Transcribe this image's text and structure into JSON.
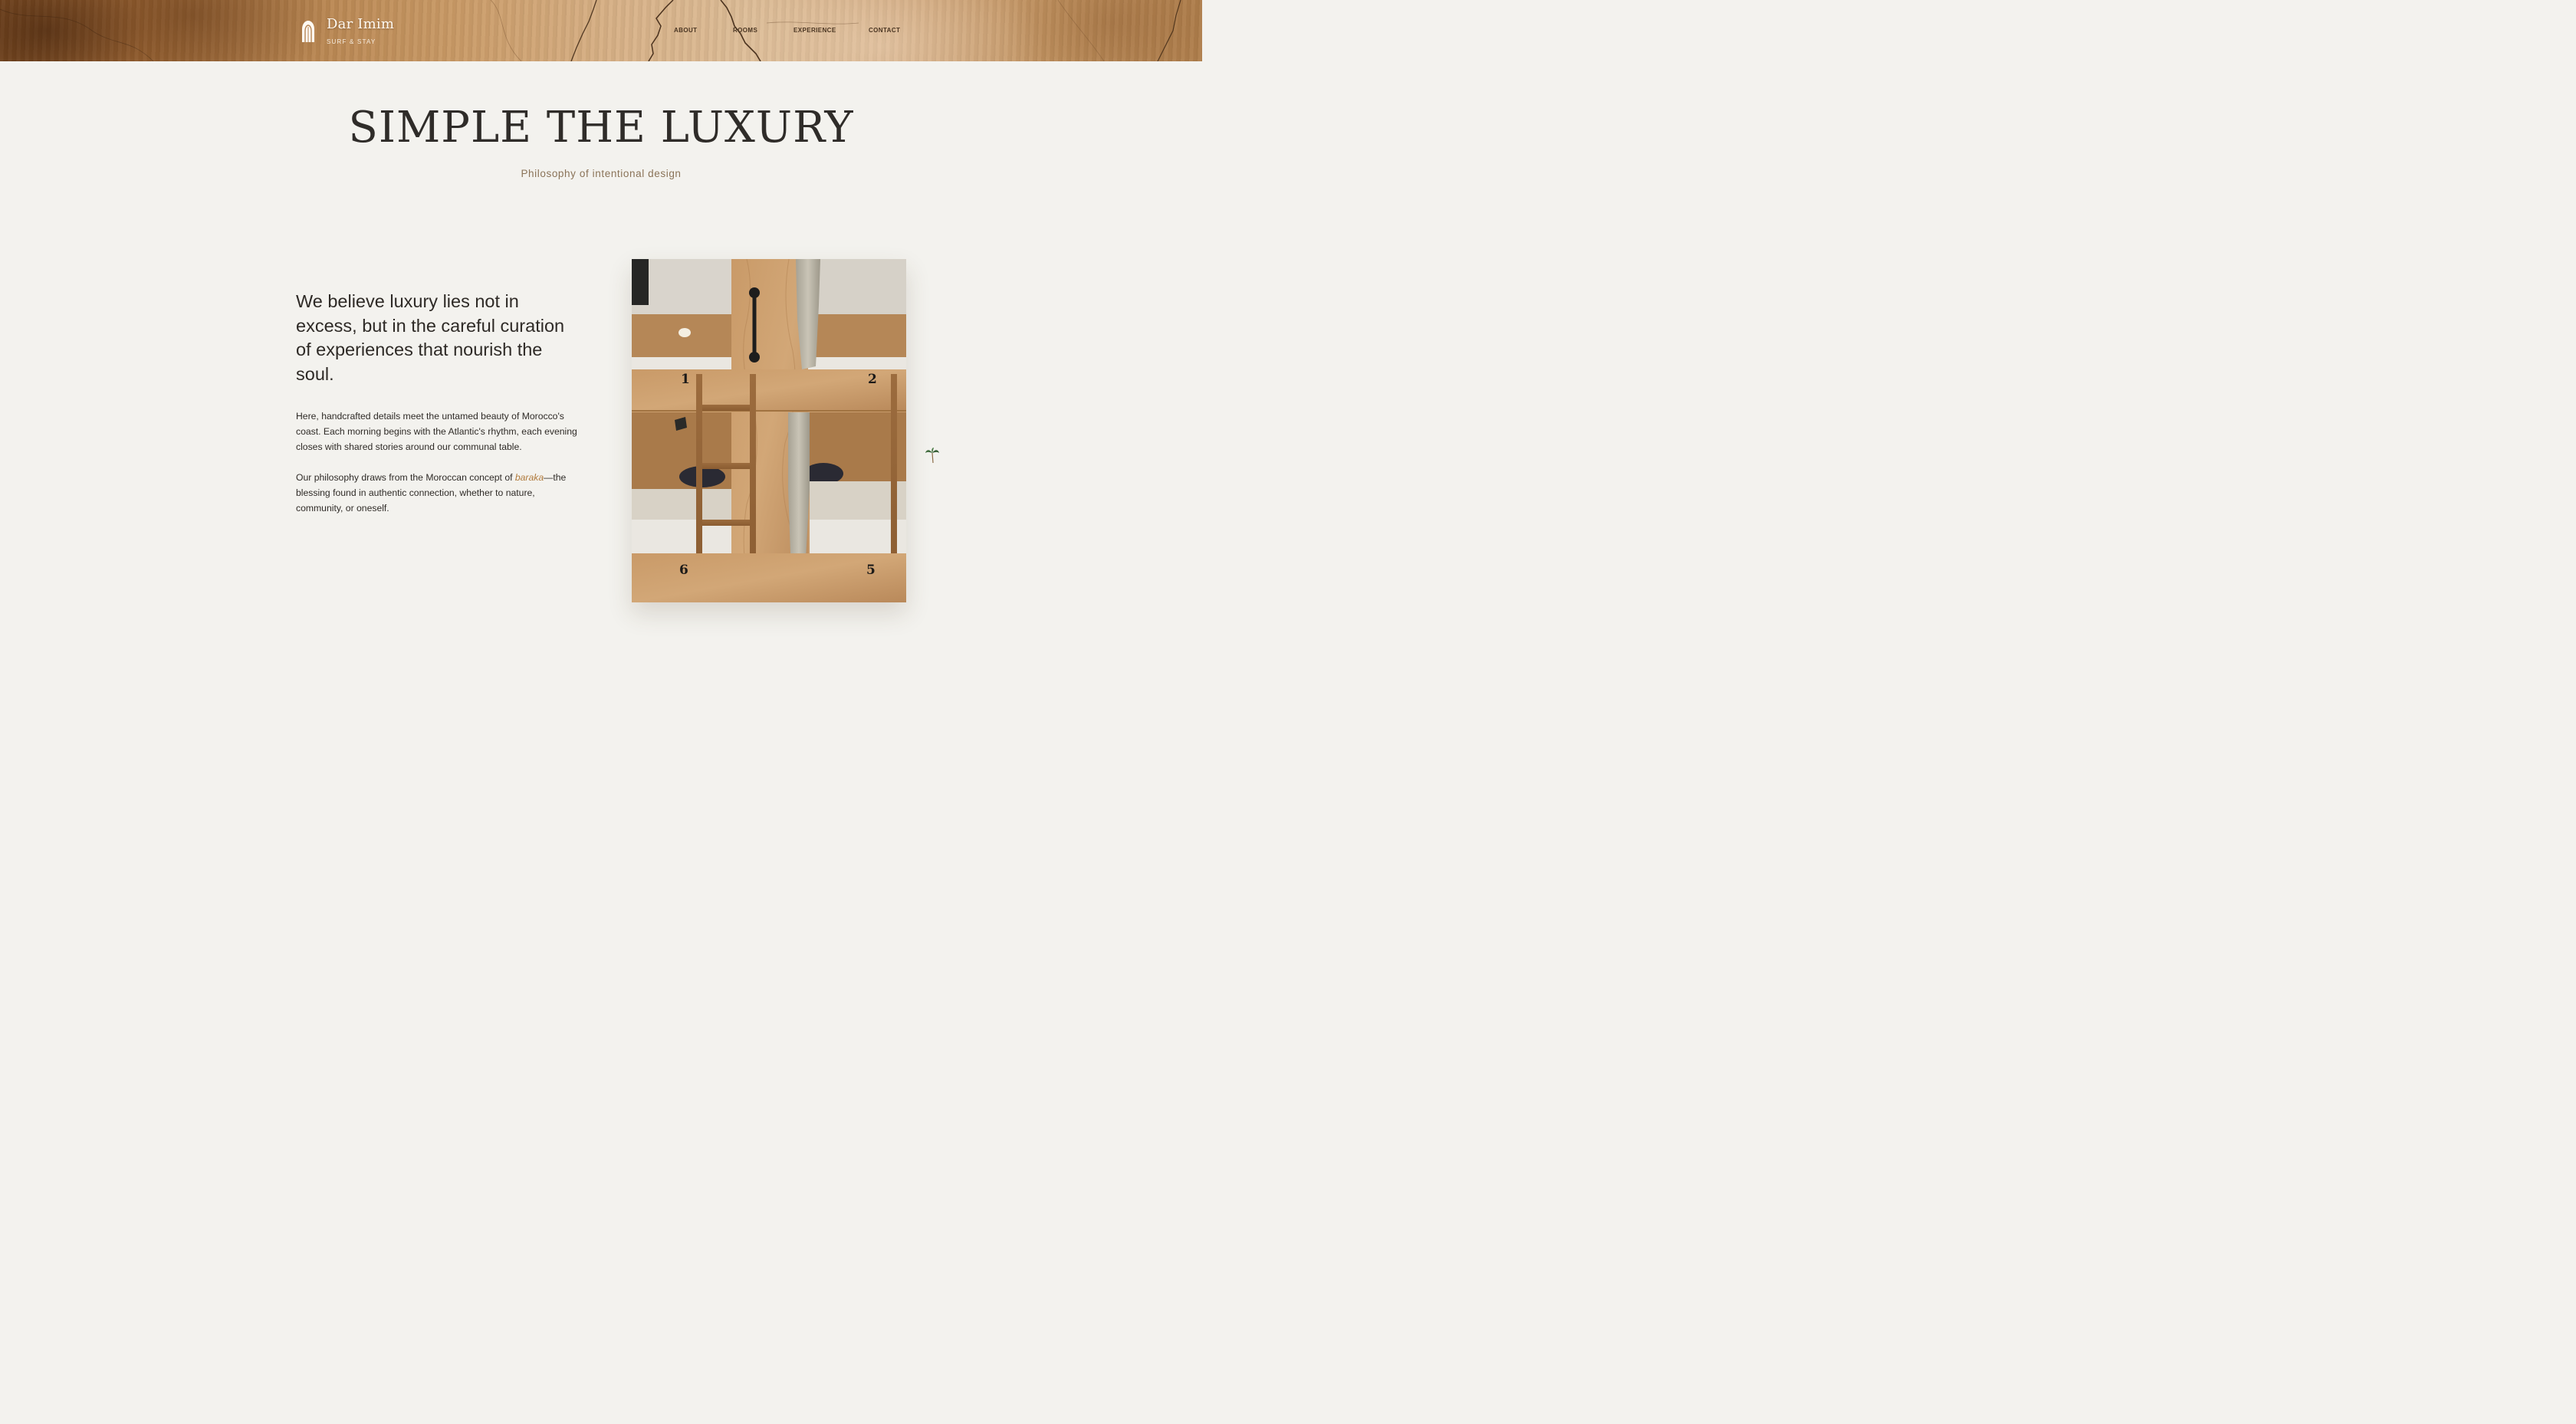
{
  "header": {
    "brand_name": "Dar Imim",
    "brand_tagline": "SURF & STAY",
    "nav": [
      {
        "label": "ABOUT"
      },
      {
        "label": "ROOMS"
      },
      {
        "label": "EXPERIENCE"
      },
      {
        "label": "CONTACT"
      }
    ]
  },
  "hero": {
    "title": "SIMPLE THE LUXURY",
    "subtitle": "Philosophy of intentional design"
  },
  "philosophy": {
    "lead": "We believe luxury lies not in excess, but in the careful curation of experiences that nourish the soul.",
    "paragraph_1": "Here, handcrafted details meet the untamed beauty of Morocco's coast. Each morning begins with the Atlantic's rhythm, each evening closes with shared stories around our communal table.",
    "paragraph_2_before": "Our philosophy draws from the Moroccan concept of ",
    "paragraph_2_emphasis": "baraka",
    "paragraph_2_after": "—the blessing found in authentic connection, whether to nature, community, or oneself."
  },
  "photo": {
    "bunk_numbers": [
      "1",
      "2",
      "6",
      "5"
    ]
  },
  "icons": {
    "brand": "arch-door-icon",
    "decor": "palm-leaf-icon"
  },
  "colors": {
    "page_background": "#f3f2ee",
    "accent": "#b07a3c",
    "subtitle": "#8a7358",
    "text": "#2e2a26"
  }
}
